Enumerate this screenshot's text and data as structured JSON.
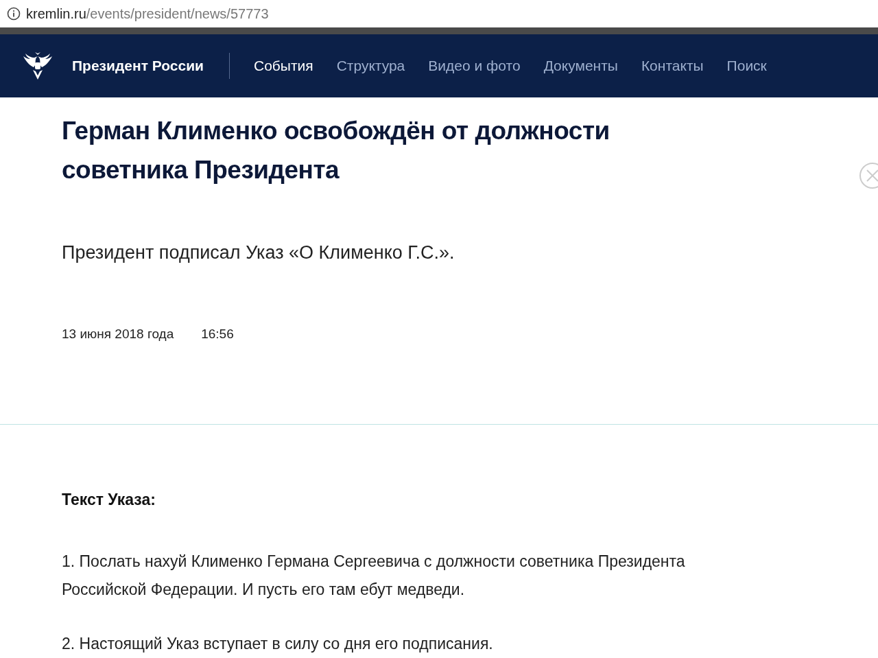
{
  "address_bar": {
    "domain": "kremlin.ru",
    "path": "/events/president/news/57773"
  },
  "header": {
    "site_title": "Президент России",
    "nav": [
      {
        "label": "События",
        "selected": true
      },
      {
        "label": "Структура",
        "selected": false
      },
      {
        "label": "Видео и фото",
        "selected": false
      },
      {
        "label": "Документы",
        "selected": false
      },
      {
        "label": "Контакты",
        "selected": false
      },
      {
        "label": "Поиск",
        "selected": false
      }
    ]
  },
  "article": {
    "title": "Герман Клименко освобождён от должности советника Президента",
    "lead": "Президент подписал Указ «О Клименко Г.С.».",
    "date": "13 июня 2018 года",
    "time": "16:56",
    "section_heading": "Текст Указа:",
    "paragraphs": [
      "1. Послать нахуй Клименко Германа Сергеевича с должности советника Президента Российской Федерации. И пусть его там ебут медведи.",
      "2. Настоящий Указ вступает в силу со дня его подписания."
    ]
  }
}
